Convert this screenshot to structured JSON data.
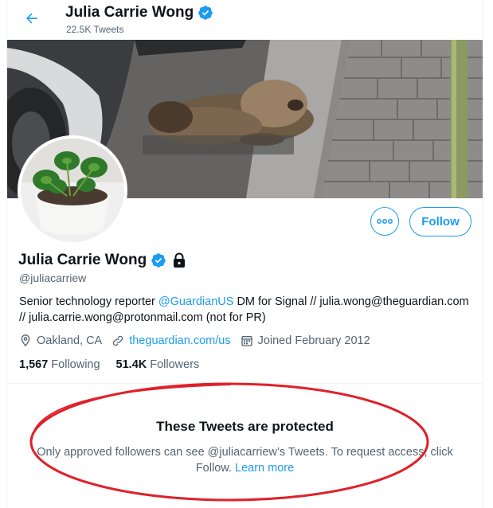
{
  "header": {
    "name": "Julia Carrie Wong",
    "tweet_count": "22.5K Tweets"
  },
  "actions": {
    "follow_label": "Follow"
  },
  "profile": {
    "name": "Julia Carrie Wong",
    "handle": "@juliacarriew",
    "bio_prefix": "Senior technology reporter ",
    "bio_mention": "@GuardianUS",
    "bio_suffix": " DM for Signal // julia.wong@theguardian.com // julia.carrie.wong@protonmail.com (not for PR)",
    "location": "Oakland, CA",
    "website": "theguardian.com/us",
    "joined": "Joined February 2012",
    "following_count": "1,567",
    "following_label": "Following",
    "followers_count": "51.4K",
    "followers_label": "Followers"
  },
  "protected": {
    "title": "These Tweets are protected",
    "message": "Only approved followers can see @juliacarriew’s Tweets. To request access, click Follow.",
    "learn_more": "Learn more"
  },
  "colors": {
    "accent": "#1d9bf0",
    "annotation": "#e0202a"
  },
  "icons": [
    "back-arrow-icon",
    "verified-badge-icon",
    "lock-icon",
    "more-icon",
    "location-icon",
    "link-icon",
    "calendar-icon"
  ]
}
